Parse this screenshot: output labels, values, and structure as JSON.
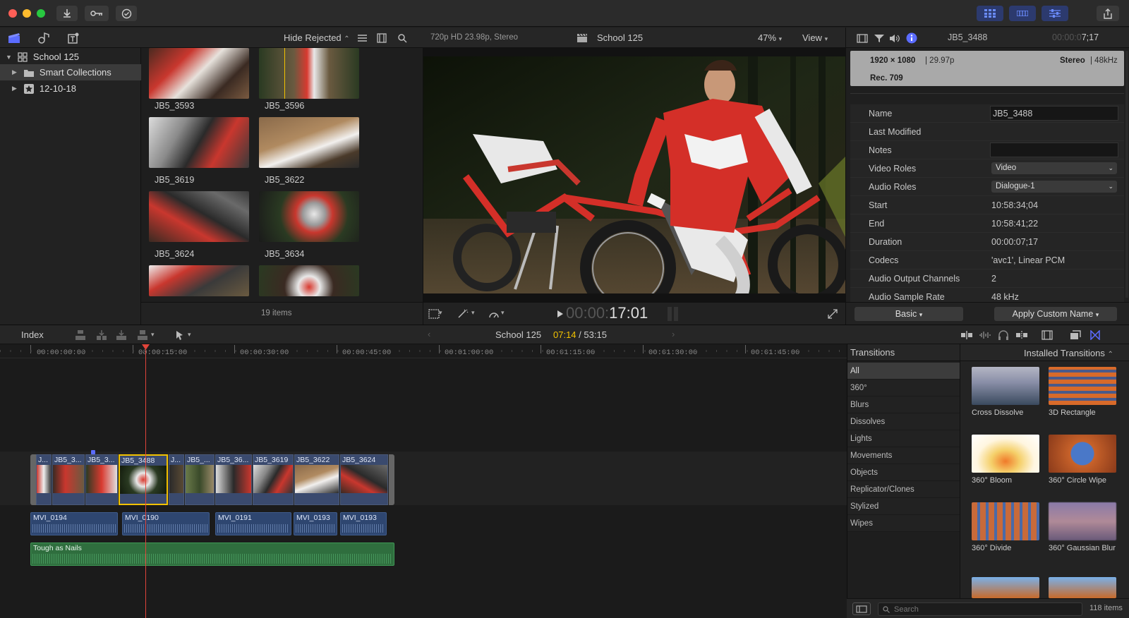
{
  "toolbar": {
    "import_icon": "download-icon",
    "keywords_icon": "key-icon",
    "background_tasks_icon": "checkmark-circle-icon",
    "share_icon": "share-icon"
  },
  "library": {
    "library_name": "School 125",
    "items": [
      {
        "label": "Smart Collections"
      },
      {
        "label": "12-10-18"
      }
    ]
  },
  "browser": {
    "filter_label": "Hide Rejected",
    "clips": [
      {
        "name": "JB5_3593"
      },
      {
        "name": "JB5_3596"
      },
      {
        "name": "JB5_3619"
      },
      {
        "name": "JB5_3622"
      },
      {
        "name": "JB5_3624"
      },
      {
        "name": "JB5_3634"
      }
    ],
    "item_count": "19 items"
  },
  "viewer": {
    "format": "720p HD 23.98p, Stereo",
    "project": "School 125",
    "zoom": "47%",
    "view_label": "View",
    "timecode_dim": "00:00:",
    "timecode": "17:01"
  },
  "inspector": {
    "clip_name": "JB5_3488",
    "duration_dim": "00:00:0",
    "duration": "7;17",
    "resolution": "1920 × 1080",
    "framerate": "| 29.97p",
    "audio": "Stereo",
    "samplerate": "| 48kHz",
    "colorspace": "Rec. 709",
    "rows": [
      {
        "label": "Name",
        "value": "JB5_3488"
      },
      {
        "label": "Last Modified",
        "value": ""
      },
      {
        "label": "Notes",
        "value": ""
      },
      {
        "label": "Video Roles",
        "value": "Video"
      },
      {
        "label": "Audio Roles",
        "value": "Dialogue-1"
      },
      {
        "label": "Start",
        "value": "10:58:34;04"
      },
      {
        "label": "End",
        "value": "10:58:41;22"
      },
      {
        "label": "Duration",
        "value": "00:00:07;17"
      },
      {
        "label": "Codecs",
        "value": "'avc1', Linear PCM"
      },
      {
        "label": "Audio Output Channels",
        "value": "2"
      },
      {
        "label": "Audio Sample Rate",
        "value": "48 kHz"
      }
    ],
    "metadata_view": "Basic",
    "apply_button": "Apply Custom Name"
  },
  "timeline": {
    "index_label": "Index",
    "project": "School 125",
    "position": "07:14",
    "total": "/ 53:15",
    "ruler": [
      "00:00:00:00",
      "00:00:15:00",
      "00:00:30:00",
      "00:00:45:00",
      "00:01:00:00",
      "00:01:15:00",
      "00:01:30:00",
      "00:01:45:00"
    ],
    "video_clips": [
      {
        "name": "J..."
      },
      {
        "name": "JB5_3..."
      },
      {
        "name": "JB5_3..."
      },
      {
        "name": "JB5_3488"
      },
      {
        "name": "J..."
      },
      {
        "name": "JB5_..."
      },
      {
        "name": "JB5_36..."
      },
      {
        "name": "JB5_3619"
      },
      {
        "name": "JB5_3622"
      },
      {
        "name": "JB5_3624"
      }
    ],
    "audio_clips": [
      {
        "name": "MVI_0194"
      },
      {
        "name": "MVI_0190"
      },
      {
        "name": "MVI_0191"
      },
      {
        "name": "MVI_0193"
      },
      {
        "name": "MVI_0193"
      }
    ],
    "music": "Tough as Nails"
  },
  "transitions": {
    "title": "Transitions",
    "scope": "Installed Transitions",
    "categories": [
      "All",
      "360°",
      "Blurs",
      "Dissolves",
      "Lights",
      "Movements",
      "Objects",
      "Replicator/Clones",
      "Stylized",
      "Wipes"
    ],
    "items": [
      {
        "name": "Cross Dissolve"
      },
      {
        "name": "3D Rectangle"
      },
      {
        "name": "360° Bloom"
      },
      {
        "name": "360° Circle Wipe"
      },
      {
        "name": "360° Divide"
      },
      {
        "name": "360° Gaussian Blur"
      }
    ],
    "search_placeholder": "Search",
    "count": "118 items"
  },
  "colors": {
    "playhead": "#e0443a",
    "selection": "#f2c200",
    "accent": "#5b6cff",
    "music": "#2f8a4a"
  }
}
